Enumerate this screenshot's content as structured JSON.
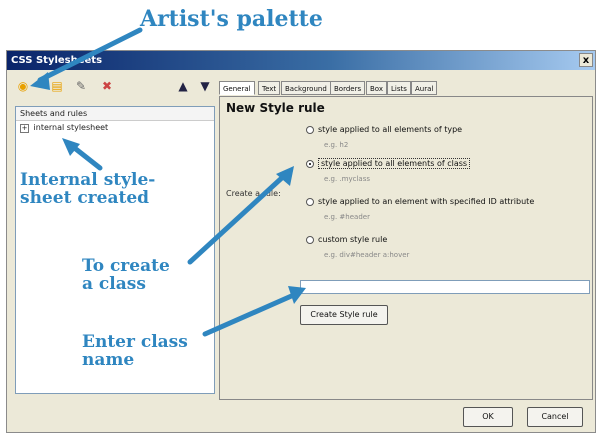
{
  "callouts": {
    "title": "Artist's palette",
    "internal": [
      "Internal style-",
      "sheet created"
    ],
    "create_class": [
      "To create",
      "a class"
    ],
    "enter_name": [
      "Enter class",
      "name"
    ]
  },
  "window": {
    "title": "CSS Stylesheets",
    "close_glyph": "x"
  },
  "toolbar": {
    "icons": [
      "palette-icon",
      "dropdown-arrow-icon",
      "open-folder-icon",
      "edit-icon",
      "delete-icon",
      "move-up-icon",
      "move-down-icon"
    ]
  },
  "tree": {
    "header": "Sheets and rules",
    "items": [
      {
        "label": "internal stylesheet",
        "expander": "+"
      }
    ]
  },
  "tabs": [
    {
      "label": "General",
      "active": true
    },
    {
      "label": "Text"
    },
    {
      "label": "Background"
    },
    {
      "label": "Borders"
    },
    {
      "label": "Box"
    },
    {
      "label": "Lists"
    },
    {
      "label": "Aural"
    }
  ],
  "panel": {
    "title": "New Style rule",
    "create_as_label": "Create a rule:",
    "options": [
      {
        "label": "style applied to all elements of type",
        "example": "e.g. h2",
        "selected": false
      },
      {
        "label": "style applied to all elements of class",
        "example": "e.g. .myclass",
        "selected": true
      },
      {
        "label": "style applied to an element with specified ID attribute",
        "example": "e.g. #header",
        "selected": false
      },
      {
        "label": "custom style rule",
        "example": "e.g. div#header a:hover",
        "selected": false
      }
    ],
    "class_name_value": "",
    "create_button": "Create Style rule"
  },
  "footer": {
    "ok": "OK",
    "cancel": "Cancel"
  },
  "colors": {
    "callout": "#2f86c0",
    "titlebar_start": "#0a246a"
  }
}
